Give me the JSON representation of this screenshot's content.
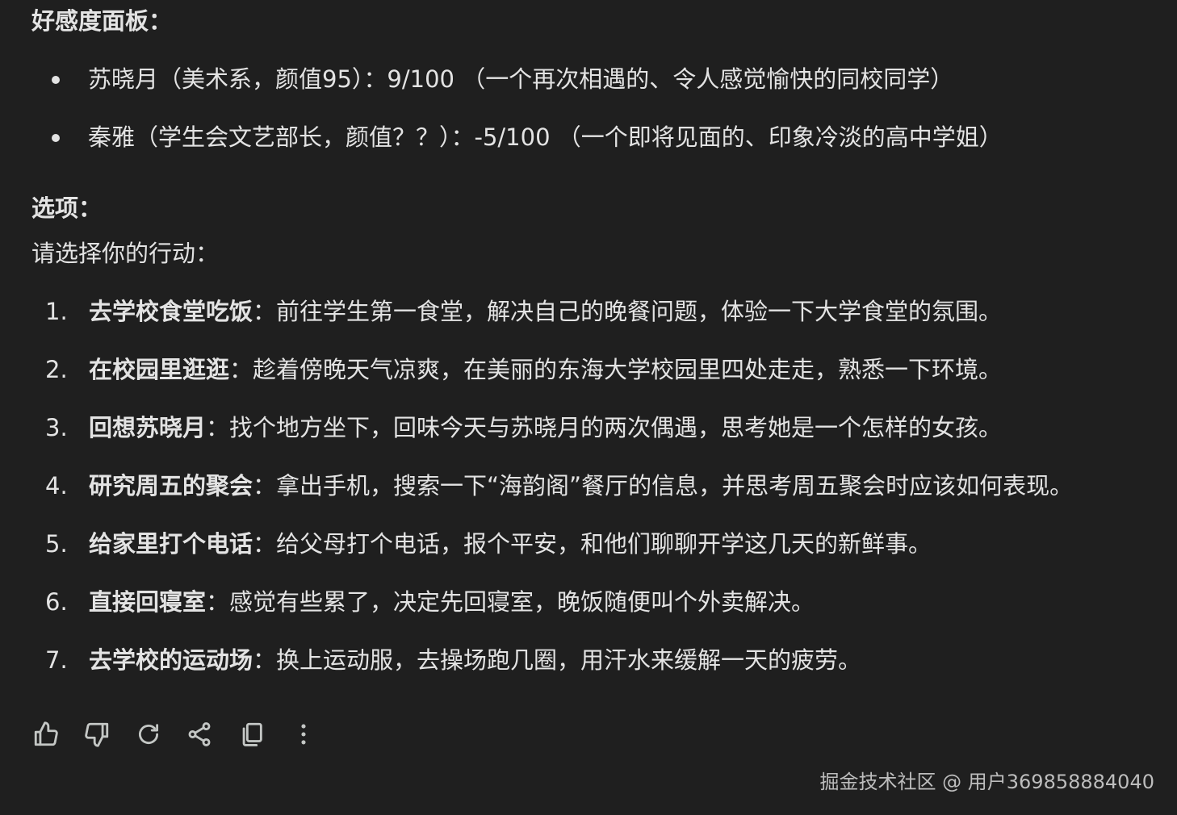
{
  "affinity_panel": {
    "heading": "好感度面板：",
    "items": [
      {
        "text": "苏晓月（美术系，颜值95）：9/100 （一个再次相遇的、令人感觉愉快的同校同学）"
      },
      {
        "text": "秦雅（学生会文艺部长，颜值？？）：-5/100 （一个即将见面的、印象冷淡的高中学姐）"
      }
    ]
  },
  "options": {
    "heading": "选项：",
    "prompt": "请选择你的行动：",
    "items": [
      {
        "num": "1.",
        "title": "去学校食堂吃饭",
        "desc": "：前往学生第一食堂，解决自己的晚餐问题，体验一下大学食堂的氛围。"
      },
      {
        "num": "2.",
        "title": "在校园里逛逛",
        "desc": "：趁着傍晚天气凉爽，在美丽的东海大学校园里四处走走，熟悉一下环境。"
      },
      {
        "num": "3.",
        "title": "回想苏晓月",
        "desc": "：找个地方坐下，回味今天与苏晓月的两次偶遇，思考她是一个怎样的女孩。"
      },
      {
        "num": "4.",
        "title": "研究周五的聚会",
        "desc": "：拿出手机，搜索一下“海韵阁”餐厅的信息，并思考周五聚会时应该如何表现。"
      },
      {
        "num": "5.",
        "title": "给家里打个电话",
        "desc": "：给父母打个电话，报个平安，和他们聊聊开学这几天的新鲜事。"
      },
      {
        "num": "6.",
        "title": "直接回寝室",
        "desc": "：感觉有些累了，决定先回寝室，晚饭随便叫个外卖解决。"
      },
      {
        "num": "7.",
        "title": "去学校的运动场",
        "desc": "：换上运动服，去操场跑几圈，用汗水来缓解一天的疲劳。"
      }
    ]
  },
  "action_bar": {
    "icons": [
      "thumbs-up-icon",
      "thumbs-down-icon",
      "redo-icon",
      "share-icon",
      "copy-icon",
      "more-vert-icon"
    ]
  },
  "watermark": {
    "text": "掘金技术社区 @ 用户369858884040"
  },
  "colors": {
    "background": "#1f1f1f",
    "text": "#e3e3e3",
    "icon": "#c4c7c5"
  }
}
